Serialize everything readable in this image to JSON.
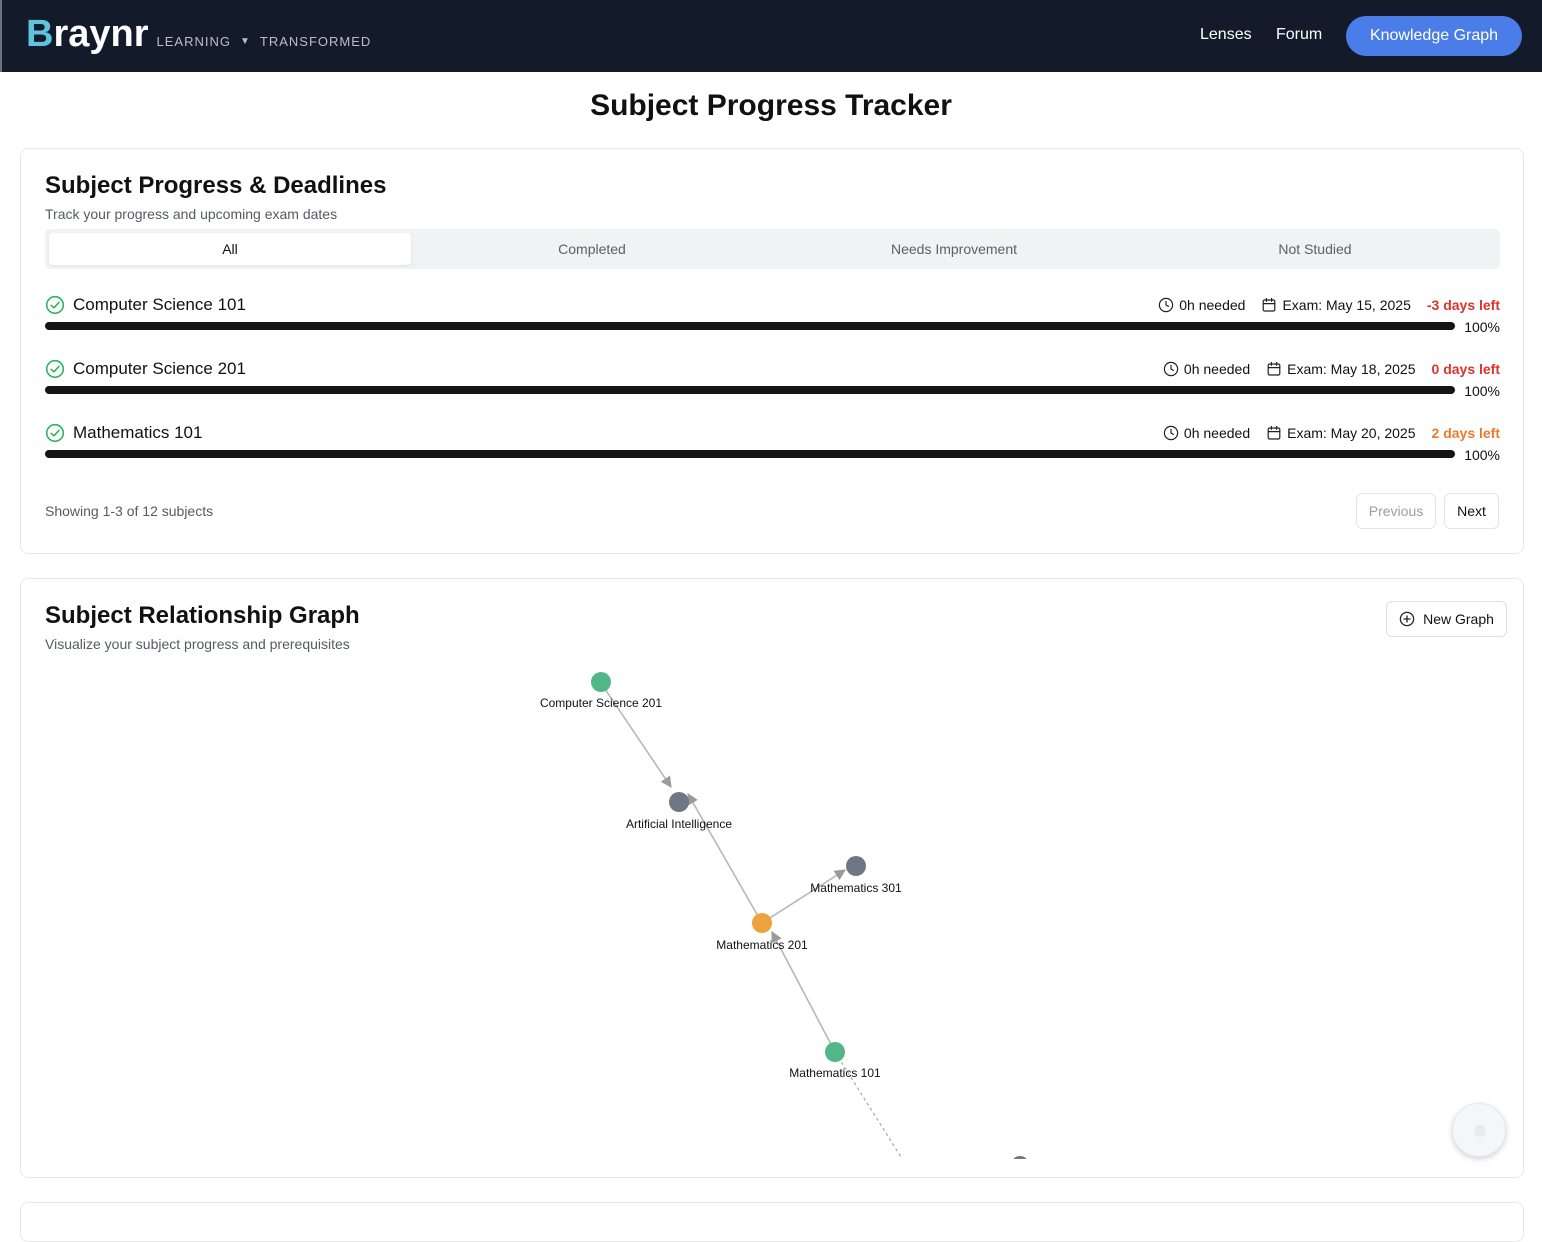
{
  "header": {
    "brand_first": "B",
    "brand_rest": "raynr",
    "tagline_left": "LEARNING",
    "tagline_right": "TRANSFORMED",
    "nav": [
      "Lenses",
      "Forum"
    ],
    "cta": "Knowledge Graph"
  },
  "page_title": "Subject Progress Tracker",
  "progress_card": {
    "title": "Subject Progress & Deadlines",
    "subtitle": "Track your progress and upcoming exam dates",
    "tabs": [
      "All",
      "Completed",
      "Needs Improvement",
      "Not Studied"
    ],
    "active_tab": "All",
    "subjects": [
      {
        "name": "Computer Science 101",
        "hours": "0h needed",
        "exam": "Exam: May 15, 2025",
        "days": "-3 days left",
        "days_color": "#d9352b",
        "progress": 100,
        "progress_label": "100%"
      },
      {
        "name": "Computer Science 201",
        "hours": "0h needed",
        "exam": "Exam: May 18, 2025",
        "days": "0 days left",
        "days_color": "#d9352b",
        "progress": 100,
        "progress_label": "100%"
      },
      {
        "name": "Mathematics 101",
        "hours": "0h needed",
        "exam": "Exam: May 20, 2025",
        "days": "2 days left",
        "days_color": "#ee7a2d",
        "progress": 100,
        "progress_label": "100%"
      }
    ],
    "showing": "Showing 1-3 of 12 subjects",
    "prev_label": "Previous",
    "next_label": "Next"
  },
  "graph_card": {
    "title": "Subject Relationship Graph",
    "subtitle": "Visualize your subject progress and prerequisites",
    "new_graph_label": "New Graph",
    "nodes": [
      {
        "label": "Computer Science 201",
        "color": "#52b788"
      },
      {
        "label": "Artificial Intelligence",
        "color": "#717684"
      },
      {
        "label": "Mathematics 301",
        "color": "#717684"
      },
      {
        "label": "Mathematics 201",
        "color": "#eaa33f"
      },
      {
        "label": "Mathematics 101",
        "color": "#52b788"
      }
    ]
  },
  "icons": {
    "check": "check-circle-icon",
    "clock": "clock-icon",
    "calendar": "calendar-icon",
    "plus": "plus-circle-icon"
  },
  "colors": {
    "header_bg": "#131a2a",
    "accent": "#4a7de8",
    "brand_b": "#5fc2df",
    "completed": "#52b788",
    "in_progress": "#eaa33f",
    "not_started": "#717684"
  }
}
